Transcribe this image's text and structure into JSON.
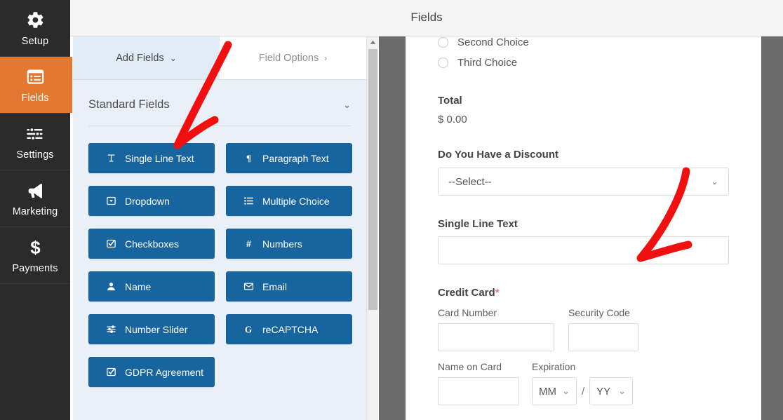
{
  "header": {
    "title": "Fields"
  },
  "sidebar": {
    "items": [
      {
        "label": "Setup",
        "icon": "gear-icon",
        "active": false
      },
      {
        "label": "Fields",
        "icon": "list-panel-icon",
        "active": true
      },
      {
        "label": "Settings",
        "icon": "sliders-icon",
        "active": false
      },
      {
        "label": "Marketing",
        "icon": "megaphone-icon",
        "active": false
      },
      {
        "label": "Payments",
        "icon": "dollar-icon",
        "active": false
      }
    ],
    "active_color": "#e27730",
    "background_color": "#2b2b2b"
  },
  "builder": {
    "tabs": [
      {
        "label": "Add Fields",
        "caret": "⌄",
        "active": true
      },
      {
        "label": "Field Options",
        "caret": "›",
        "active": false
      }
    ],
    "section": {
      "title": "Standard Fields",
      "caret": "⌄"
    },
    "button_color": "#18649e",
    "fields": [
      {
        "label": "Single Line Text",
        "icon": "text-cursor-icon"
      },
      {
        "label": "Paragraph Text",
        "icon": "pilcrow-icon"
      },
      {
        "label": "Dropdown",
        "icon": "dropdown-icon"
      },
      {
        "label": "Multiple Choice",
        "icon": "list-radio-icon"
      },
      {
        "label": "Checkboxes",
        "icon": "checkbox-icon"
      },
      {
        "label": "Numbers",
        "icon": "hash-icon"
      },
      {
        "label": "Name",
        "icon": "user-icon"
      },
      {
        "label": "Email",
        "icon": "envelope-icon"
      },
      {
        "label": "Number Slider",
        "icon": "slider-icon"
      },
      {
        "label": "reCAPTCHA",
        "icon": "google-g-icon"
      },
      {
        "label": "GDPR Agreement",
        "icon": "checkbox-icon"
      }
    ]
  },
  "preview": {
    "choices": [
      {
        "label": "Second Choice"
      },
      {
        "label": "Third Choice"
      }
    ],
    "total": {
      "label": "Total",
      "value": "$ 0.00"
    },
    "discount": {
      "label": "Do You Have a Discount",
      "selected": "--Select--",
      "caret": "⌄"
    },
    "single_line_text": {
      "label": "Single Line Text",
      "value": ""
    },
    "credit_card": {
      "label": "Credit Card",
      "required_marker": "*",
      "card_number": {
        "label": "Card Number",
        "value": ""
      },
      "security_code": {
        "label": "Security Code",
        "value": ""
      },
      "name_on_card": {
        "label": "Name on Card",
        "value": ""
      },
      "expiration": {
        "label": "Expiration",
        "month": "MM",
        "separator": "/",
        "year": "YY",
        "caret": "⌄"
      }
    }
  },
  "annotations": {
    "color": "#f01010",
    "arrows": [
      {
        "name": "arrow-to-single-line-text-button"
      },
      {
        "name": "arrow-to-single-line-text-preview-field"
      }
    ]
  },
  "scrollbar": {
    "arrow": "▲"
  }
}
